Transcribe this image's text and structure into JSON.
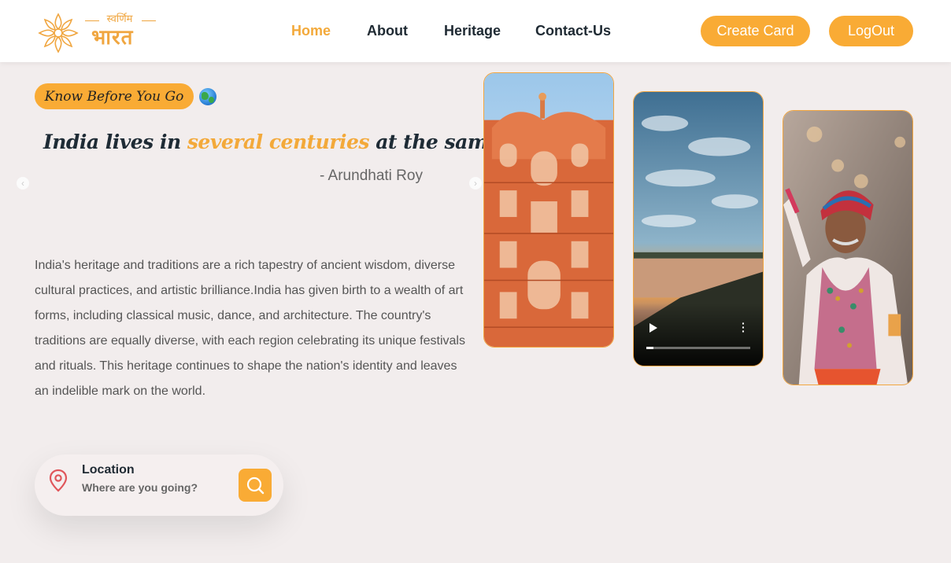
{
  "header": {
    "logo": {
      "top_text": "स्वर्णिम",
      "main_text": "भारत"
    },
    "nav": [
      {
        "label": "Home",
        "active": true
      },
      {
        "label": "About",
        "active": false
      },
      {
        "label": "Heritage",
        "active": false
      },
      {
        "label": "Contact-Us",
        "active": false
      }
    ],
    "create_card_label": "Create Card",
    "logout_label": "LogOut"
  },
  "hero": {
    "badge_label": "Know Before You Go",
    "globe_icon": "globe-icon",
    "quote_part1": "India lives in ",
    "quote_highlight": "several centuries",
    "quote_part2": " at the same time.",
    "author": "- Arundhati Roy",
    "description": "India's heritage and traditions are a rich tapestry of ancient wisdom, diverse cultural practices, and artistic brilliance.India has given birth to a wealth of art forms, including classical music, dance, and architecture. The country's traditions are equally diverse, with each region celebrating its unique festivals and rituals. This heritage continues to shape the nation's identity and leaves an indelible mark on the world."
  },
  "location": {
    "title": "Location",
    "placeholder": "Where are you going?",
    "icon": "location-pin-icon",
    "button_icon": "search-icon"
  },
  "video": {
    "progress": 0.07
  },
  "colors": {
    "accent": "#f9ab35",
    "text": "#1f2a33",
    "background": "#f2eded"
  }
}
